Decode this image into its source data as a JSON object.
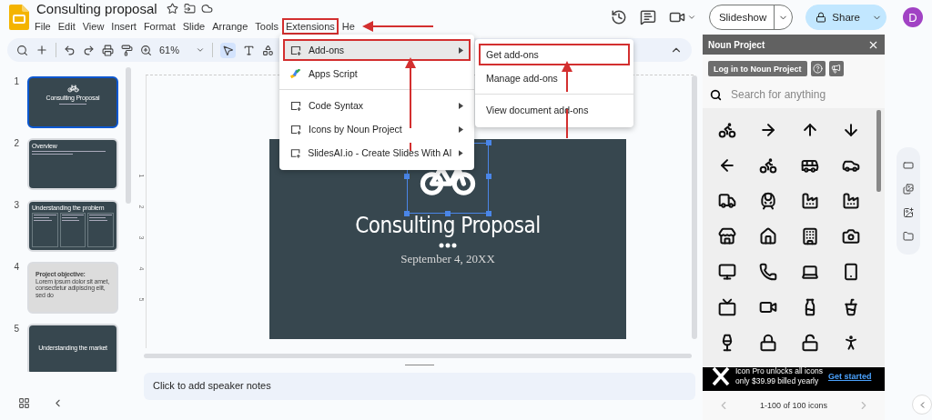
{
  "document": {
    "title": "Consulting proposal"
  },
  "menu_bar": [
    {
      "label": "File",
      "annotated": false
    },
    {
      "label": "Edit",
      "annotated": false
    },
    {
      "label": "View",
      "annotated": false
    },
    {
      "label": "Insert",
      "annotated": false
    },
    {
      "label": "Format",
      "annotated": false
    },
    {
      "label": "Slide",
      "annotated": false
    },
    {
      "label": "Arrange",
      "annotated": false
    },
    {
      "label": "Tools",
      "annotated": false
    },
    {
      "label": "Extensions",
      "annotated": true
    },
    {
      "label": "He",
      "annotated": false
    }
  ],
  "header_actions": {
    "slideshow": "Slideshow",
    "share": "Share",
    "avatar": "D"
  },
  "toolbar": {
    "zoom": "61%"
  },
  "extensions_menu": [
    {
      "kind": "addon",
      "label": "Add-ons",
      "submenu": true,
      "selected": true,
      "annotated": true
    },
    {
      "kind": "script",
      "label": "Apps Script",
      "submenu": false,
      "selected": false,
      "annotated": false
    },
    {
      "kind": "separator"
    },
    {
      "kind": "addon",
      "label": "Code Syntax",
      "submenu": true,
      "selected": false,
      "annotated": false
    },
    {
      "kind": "addon",
      "label": "Icons by Noun Project",
      "submenu": true,
      "selected": false,
      "annotated": false
    },
    {
      "kind": "addon",
      "label": "SlidesAI.io - Create Slides With AI",
      "submenu": true,
      "selected": false,
      "annotated": false
    }
  ],
  "addons_submenu": [
    {
      "kind": "item",
      "label": "Get add-ons",
      "annotated": true
    },
    {
      "kind": "item",
      "label": "Manage add-ons",
      "annotated": false
    },
    {
      "kind": "separator"
    },
    {
      "kind": "item",
      "label": "View document add-ons",
      "annotated": false
    }
  ],
  "slides": [
    {
      "number": "1",
      "selected": true,
      "kind": "title",
      "title": "Consulting Proposal"
    },
    {
      "number": "2",
      "selected": false,
      "kind": "text",
      "title": "Overview"
    },
    {
      "number": "3",
      "selected": false,
      "kind": "columns",
      "title": "Understanding the problem"
    },
    {
      "number": "4",
      "selected": false,
      "kind": "light",
      "title": "Project objective:",
      "body": "Lorem ipsum dolor sit amet, consectetur adipiscing elit, sed do"
    },
    {
      "number": "5",
      "selected": false,
      "kind": "section",
      "title": "Understanding the market"
    }
  ],
  "ruler": [
    "1",
    "2",
    "3",
    "4",
    "5"
  ],
  "slide": {
    "title": "Consulting Proposal",
    "date": "September 4, 20XX",
    "icon_selected": true
  },
  "speaker_notes": {
    "placeholder": "Click to add speaker notes"
  },
  "noun_project": {
    "title": "Noun Project",
    "login": "Log in to Noun Project",
    "search": {
      "placeholder": "Search for anything"
    },
    "promo": {
      "line1": "Icon Pro unlocks all icons",
      "line2": "only $39.99 billed yearly",
      "link": "Get started"
    },
    "pager": "1-100 of 100 icons"
  }
}
